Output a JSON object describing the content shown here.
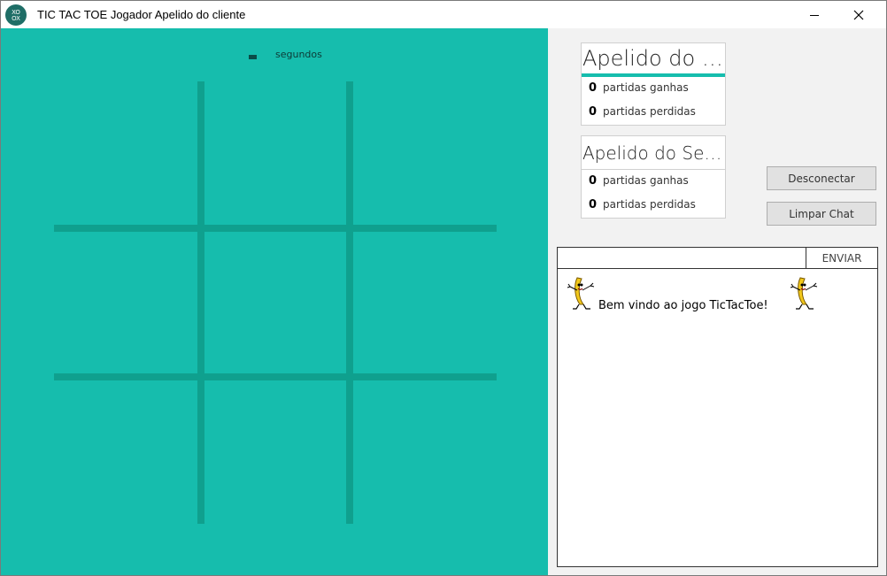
{
  "window": {
    "title": "TIC TAC TOE Jogador Apelido do cliente",
    "icon": "tictactoe-app-icon",
    "minimize_icon": "minimize-icon",
    "close_icon": "close-icon"
  },
  "board": {
    "timer_value": "",
    "timer_unit": "segundos",
    "cells": [
      "",
      "",
      "",
      "",
      "",
      "",
      "",
      "",
      ""
    ],
    "colors": {
      "background": "#16bdad",
      "grid": "#0fa08e"
    }
  },
  "players": {
    "client": {
      "name": "Apelido do cli...",
      "wins": "0",
      "wins_label": "partidas ganhas",
      "losses": "0",
      "losses_label": "partidas perdidas",
      "active": true
    },
    "server": {
      "name": "Apelido do Ser...",
      "wins": "0",
      "wins_label": "partidas ganhas",
      "losses": "0",
      "losses_label": "partidas perdidas",
      "active": false
    }
  },
  "actions": {
    "disconnect_label": "Desconectar",
    "clear_chat_label": "Limpar Chat"
  },
  "chat": {
    "input_value": "",
    "input_placeholder": "",
    "send_label": "ENVIAR",
    "welcome_message": "Bem vindo ao jogo TicTacToe!",
    "emoticon": "dancing-banana-icon"
  }
}
